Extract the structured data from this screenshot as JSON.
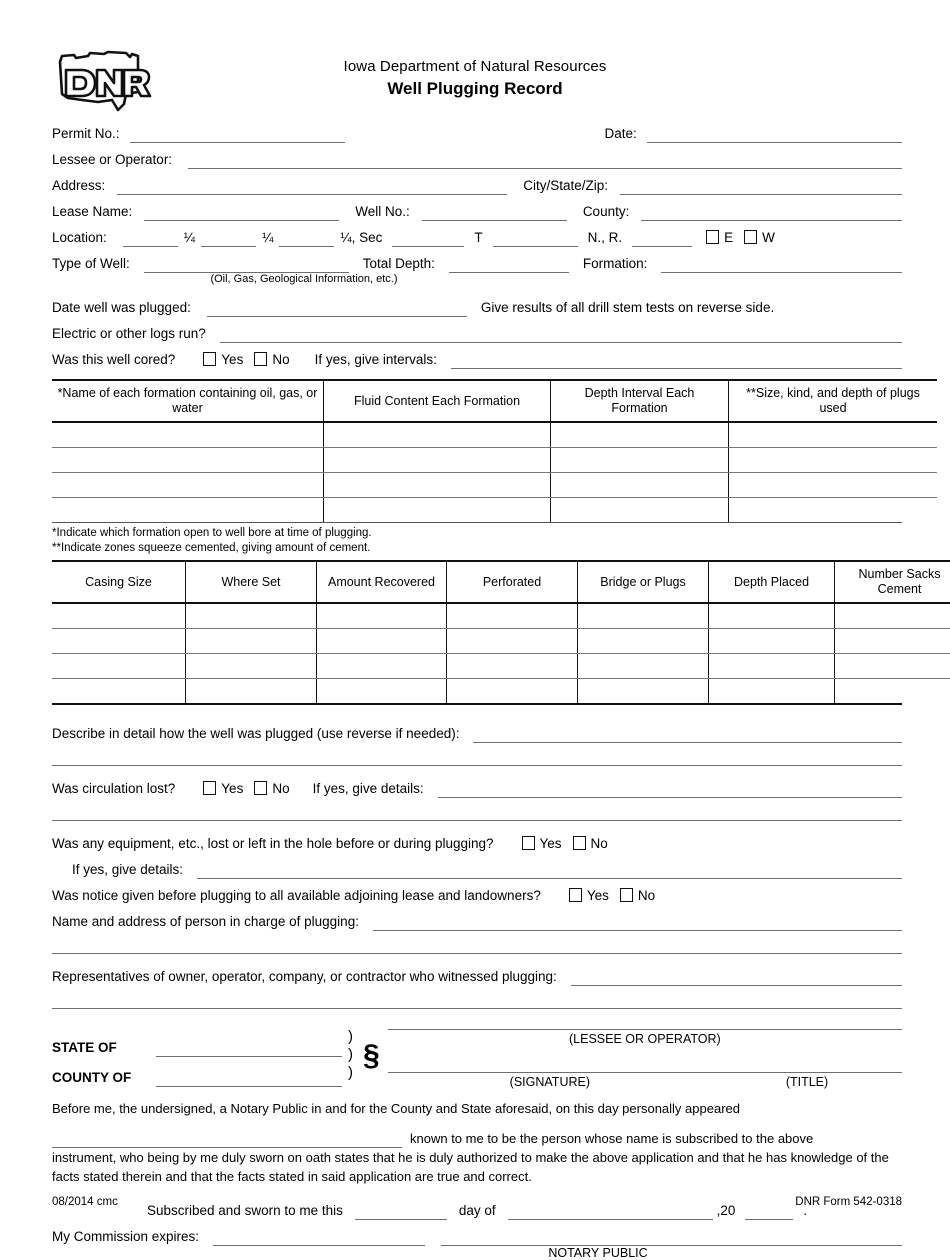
{
  "header": {
    "logo_alt": "Iowa DNR logo",
    "logo_text": "DNR",
    "agency": "Iowa Department of Natural Resources",
    "form_title": "Well Plugging Record"
  },
  "fields": {
    "permit_no": "Permit No.:",
    "date": "Date:",
    "lessee_or_operator": "Lessee or Operator:",
    "address": "Address:",
    "city_state_zip": "City/State/Zip:",
    "lease_name": "Lease Name:",
    "well_no": "Well No.:",
    "county": "County:",
    "location": "Location:",
    "quarter": "¼",
    "quarter_sec": "¼, Sec",
    "t": "T",
    "n_r": "N.,  R.",
    "east": "E",
    "west": "W",
    "type_of_well": "Type of Well:",
    "type_of_well_note": "(Oil, Gas, Geological Information, etc.)",
    "total_depth": "Total Depth:",
    "formation": "Formation:",
    "date_well_plugged": "Date well was plugged:",
    "drill_stem_note": "Give results of all drill stem tests on reverse side.",
    "electric_logs": "Electric or other logs run?",
    "well_cored": "Was this well cored?",
    "yes": "Yes",
    "no": "No",
    "if_yes_intervals": "If yes, give intervals:"
  },
  "formation_table": {
    "headers": [
      "*Name of each formation containing oil, gas, or water",
      "Fluid Content Each Formation",
      "Depth Interval Each Formation",
      "**Size, kind, and depth of plugs used"
    ],
    "rows": [
      [
        "",
        "",
        "",
        ""
      ],
      [
        "",
        "",
        "",
        ""
      ],
      [
        "",
        "",
        "",
        ""
      ],
      [
        "",
        "",
        "",
        ""
      ]
    ],
    "note1": "*Indicate which formation open to well bore at time of plugging.",
    "note2": "**Indicate zones squeeze cemented, giving amount of cement."
  },
  "casing_table": {
    "headers": [
      "Casing Size",
      "Where Set",
      "Amount Recovered",
      "Perforated",
      "Bridge or Plugs",
      "Depth Placed",
      "Number Sacks Cement"
    ],
    "rows": [
      [
        "",
        "",
        "",
        "",
        "",
        "",
        ""
      ],
      [
        "",
        "",
        "",
        "",
        "",
        "",
        ""
      ],
      [
        "",
        "",
        "",
        "",
        "",
        "",
        ""
      ],
      [
        "",
        "",
        "",
        "",
        "",
        "",
        ""
      ]
    ]
  },
  "questions": {
    "describe": "Describe in detail how the well was plugged (use reverse if needed):",
    "circulation_lost": "Was circulation lost?",
    "if_yes_details": "If yes, give details:",
    "equipment_lost": "Was any equipment, etc., lost or left in the hole before or during plugging?",
    "if_yes_details_2": "If yes, give details:",
    "notice_given": "Was notice given before plugging to all available adjoining lease and landowners?",
    "name_address": "Name and address of person in charge of plugging:",
    "representatives": "Representatives of owner, operator, company, or contractor who witnessed plugging:",
    "yes": "Yes",
    "no": "No"
  },
  "notary": {
    "state_of": "STATE OF",
    "county_of": "COUNTY OF",
    "paren": ")",
    "section_symbol": "§",
    "lessee_or_operator_cap": "(LESSEE OR OPERATOR)",
    "signature_cap": "(SIGNATURE)",
    "title_cap": "(TITLE)",
    "before_me": "Before me, the undersigned, a Notary Public in and for the County and State aforesaid, on this day personally appeared",
    "known_to_me": "known to me to be the person whose name is subscribed to the above",
    "instrument_line1": "instrument, who being by me duly sworn on oath states that he is duly authorized to make the above application and that he has knowledge of the",
    "instrument_line2": "facts stated therein and that the facts stated in said application are true and correct.",
    "subscribed": "Subscribed and sworn to me this",
    "day_of": "day of",
    "year_prefix": ",20",
    "period": ".",
    "commission_expires": "My Commission expires:",
    "notary_public_cap": "NOTARY PUBLIC"
  },
  "footer": {
    "left": "08/2014 cmc",
    "right": "DNR Form 542-0318"
  }
}
